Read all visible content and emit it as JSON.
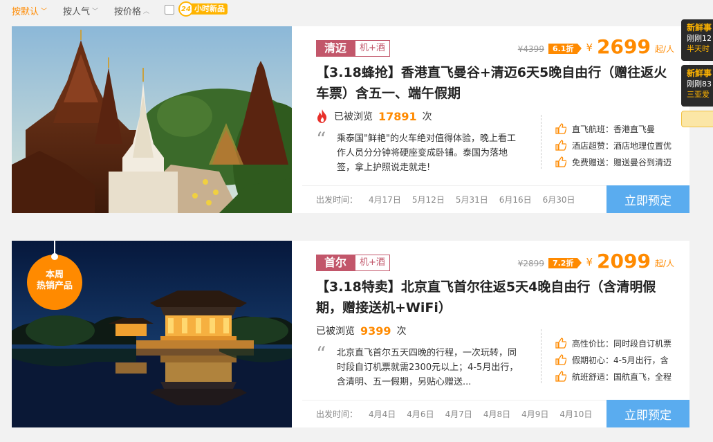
{
  "sort": {
    "default_label": "按默认",
    "popularity_label": "按人气",
    "price_label": "按价格",
    "new_badge_number": "24",
    "new_badge_text": "小时新品"
  },
  "products": [
    {
      "destination": "清迈",
      "combo": "机+酒",
      "old_price": "¥4399",
      "discount": "6.1折",
      "currency": "¥",
      "price": "2699",
      "price_unit": "起/人",
      "title": "【3.18蜂抢】香港直飞曼谷+清迈6天5晚自由行（赠往返火车票）含五一、端午假期",
      "views_prefix": "已被浏览",
      "views": "17891",
      "views_suffix": "次",
      "quote": "乘泰国\"鲜艳\"的火车绝对值得体验，晚上看工作人员分分钟将硬座变成卧铺。泰国为落地签，拿上护照说走就走!",
      "features": [
        "直飞航班：香港直飞曼",
        "酒店超赞：酒店地理位置优",
        "免费赠送：赠送曼谷到清迈"
      ],
      "dates_label": "出发时间：",
      "dates": [
        "4月17日",
        "5月12日",
        "5月31日",
        "6月16日",
        "6月30日"
      ],
      "book_label": "立即预定"
    },
    {
      "destination": "首尔",
      "combo": "机+酒",
      "old_price": "¥2899",
      "discount": "7.2折",
      "currency": "¥",
      "price": "2099",
      "price_unit": "起/人",
      "title": "【3.18特卖】北京直飞首尔往返5天4晚自由行（含清明假期，赠接送机+WiFi）",
      "views_prefix": "已被浏览",
      "views": "9399",
      "views_suffix": "次",
      "quote": "北京直飞首尔五天四晚的行程，一次玩转，同时段自订机票就需2300元以上；4-5月出行，含清明、五一假期，另贴心赠送...",
      "features": [
        "高性价比：同时段自订机票",
        "假期初心：4-5月出行，含",
        "航班舒适：国航直飞，全程"
      ],
      "dates_label": "出发时间：",
      "dates": [
        "4月4日",
        "4月6日",
        "4月7日",
        "4月8日",
        "4月9日",
        "4月10日"
      ],
      "book_label": "立即预定",
      "hot_badge_line1": "本周",
      "hot_badge_line2": "热销产品"
    }
  ],
  "side": [
    {
      "title": "新鲜事",
      "line1": "刚刚12",
      "line2": "半天时"
    },
    {
      "title": "新鲜事",
      "line1": "刚刚83",
      "line2": "三亚爱"
    }
  ]
}
